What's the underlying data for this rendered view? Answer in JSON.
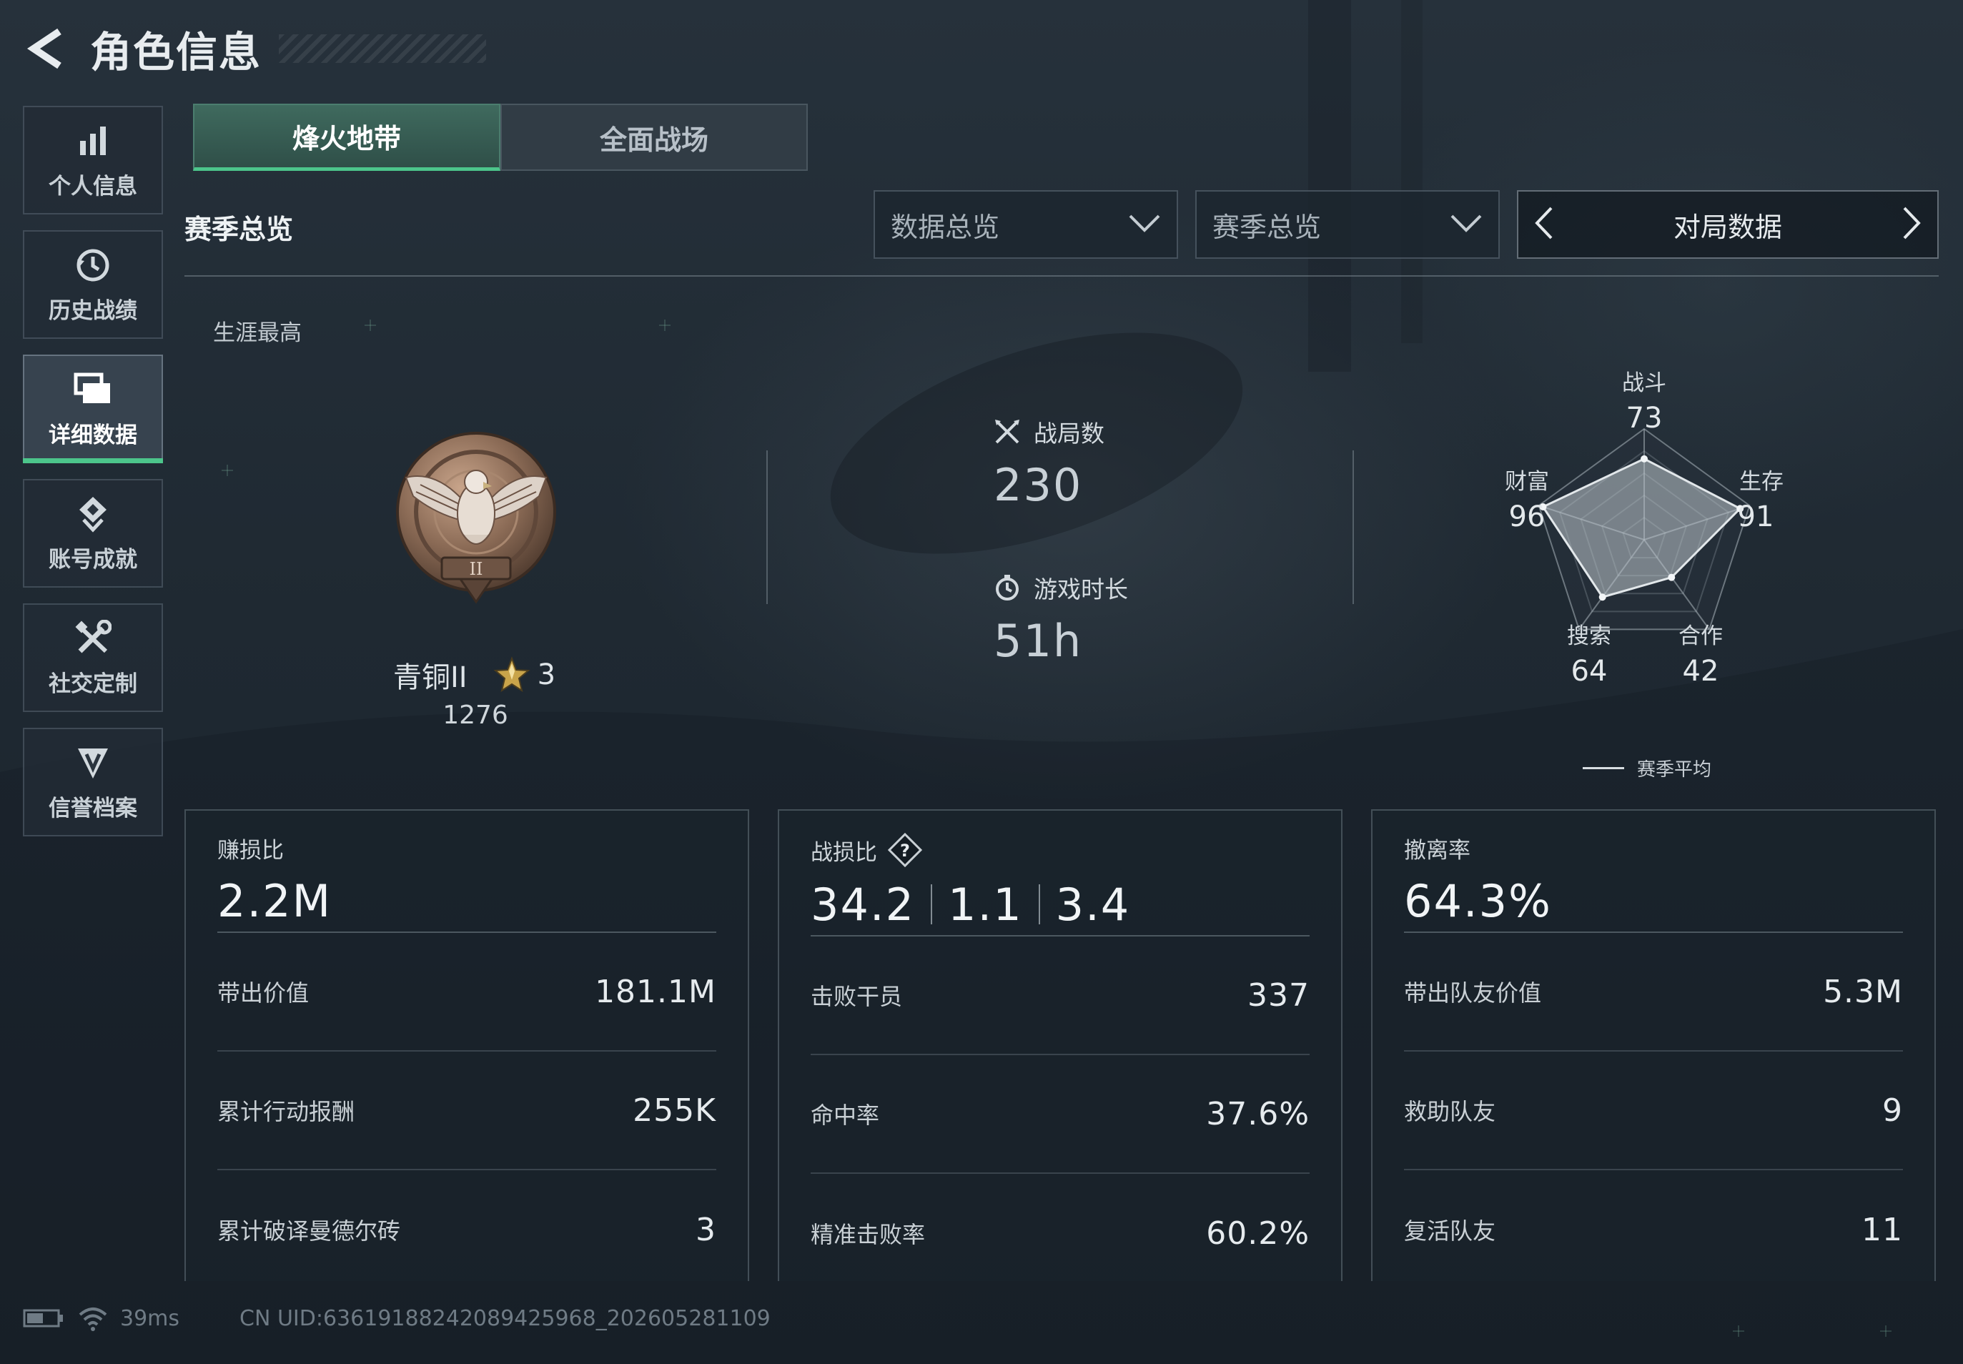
{
  "header": {
    "title": "角色信息"
  },
  "sidebar": {
    "items": [
      {
        "label": "个人信息",
        "icon": "bar-chart-icon"
      },
      {
        "label": "历史战绩",
        "icon": "history-clock-icon"
      },
      {
        "label": "详细数据",
        "icon": "cards-icon",
        "active": true
      },
      {
        "label": "账号成就",
        "icon": "achievement-icon"
      },
      {
        "label": "社交定制",
        "icon": "tools-icon"
      },
      {
        "label": "信誉档案",
        "icon": "credit-shield-icon"
      }
    ]
  },
  "tabs": [
    {
      "label": "烽火地带",
      "active": true
    },
    {
      "label": "全面战场",
      "active": false
    }
  ],
  "toolbar": {
    "section_title": "赛季总览",
    "dropdown_data": "数据总览",
    "dropdown_season": "赛季总览",
    "pager_label": "对局数据"
  },
  "overview": {
    "career_label": "生涯最高",
    "rank_name": "青铜II",
    "rank_stars": "3",
    "rank_points": "1276",
    "matches_label": "战局数",
    "matches_value": "230",
    "playtime_label": "游戏时长",
    "playtime_value": "51h"
  },
  "radar": {
    "axes": [
      {
        "label": "战斗",
        "value": "73"
      },
      {
        "label": "生存",
        "value": "91"
      },
      {
        "label": "合作",
        "value": "42"
      },
      {
        "label": "搜索",
        "value": "64"
      },
      {
        "label": "财富",
        "value": "96"
      }
    ],
    "max": 100,
    "legend": "赛季平均"
  },
  "cards": [
    {
      "title": "赚损比",
      "main": "2.2M",
      "rows": [
        {
          "label": "带出价值",
          "value": "181.1M"
        },
        {
          "label": "累计行动报酬",
          "value": "255K"
        },
        {
          "label": "累计破译曼德尔砖",
          "value": "3"
        }
      ]
    },
    {
      "title": "战损比",
      "main_parts": [
        "34.2",
        "1.1",
        "3.4"
      ],
      "rows": [
        {
          "label": "击败干员",
          "value": "337"
        },
        {
          "label": "命中率",
          "value": "37.6%"
        },
        {
          "label": "精准击败率",
          "value": "60.2%"
        }
      ]
    },
    {
      "title": "撤离率",
      "main": "64.3%",
      "rows": [
        {
          "label": "带出队友价值",
          "value": "5.3M"
        },
        {
          "label": "救助队友",
          "value": "9"
        },
        {
          "label": "复活队友",
          "value": "11"
        }
      ]
    }
  ],
  "status": {
    "ping": "39ms",
    "uid": "CN UID:63619188242089425968_202605281109"
  },
  "colors": {
    "accent_green": "#4cc58b",
    "bg_dark": "#1d2630",
    "rank_bronze": "#8a6a55",
    "star_gold": "#c9a44a"
  }
}
